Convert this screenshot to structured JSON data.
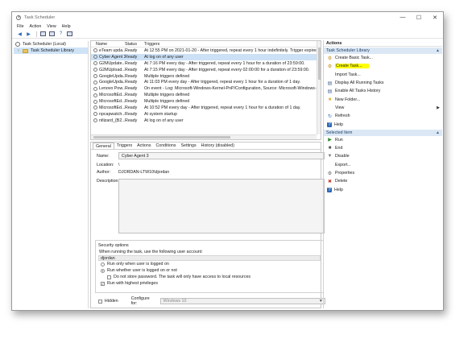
{
  "window": {
    "title": "Task Scheduler",
    "controls": {
      "minimize": "—",
      "maximize": "☐",
      "close": "✕"
    }
  },
  "menubar": [
    "File",
    "Action",
    "View",
    "Help"
  ],
  "tree": {
    "root": "Task Scheduler (Local)",
    "library": "Task Scheduler Library"
  },
  "tasklist": {
    "columns": {
      "name": "Name",
      "status": "Status",
      "triggers": "Triggers"
    },
    "rows": [
      {
        "name": "eTeam upda...",
        "status": "Ready",
        "triggers": "At 12:55 PM on 2021-01-20 - After triggered, repeat every 1 hour indefinitely. Trigger expires at 202"
      },
      {
        "name": "Cyber Agent 3",
        "status": "Ready",
        "triggers": "At log on of any user",
        "selected": true
      },
      {
        "name": "G2MUpdate...",
        "status": "Ready",
        "triggers": "At 7:16 PM every day - After triggered, repeat every 1 hour for a duration of 23:59:00."
      },
      {
        "name": "G2MUpload...",
        "status": "Ready",
        "triggers": "At 7:15 PM every day - After triggered, repeat every 02:00:00 for a duration of 23:59:00."
      },
      {
        "name": "GoogleUpda...",
        "status": "Ready",
        "triggers": "Multiple triggers defined"
      },
      {
        "name": "GoogleUpda...",
        "status": "Ready",
        "triggers": "At 11:03 PM every day - After triggered, repeat every 1 hour for a duration of 1 day."
      },
      {
        "name": "Lenovo Pow...",
        "status": "Ready",
        "triggers": "On event - Log: Microsoft-Windows-Kernel-PnP/Configuration, Source: Microsoft-Windows-Kern"
      },
      {
        "name": "MicrosoftEd...",
        "status": "Ready",
        "triggers": "Multiple triggers defined"
      },
      {
        "name": "MicrosoftEd...",
        "status": "Ready",
        "triggers": "Multiple triggers defined"
      },
      {
        "name": "MicrosoftEd...",
        "status": "Ready",
        "triggers": "At 10:52 PM every day - After triggered, repeat every 1 hour for a duration of 1 day."
      },
      {
        "name": "npcapwatch...",
        "status": "Ready",
        "triggers": "At system startup"
      },
      {
        "name": "ntlizard_{B2...",
        "status": "Ready",
        "triggers": "At log on of any user"
      }
    ]
  },
  "details": {
    "tabs": [
      "General",
      "Triggers",
      "Actions",
      "Conditions",
      "Settings",
      "History (disabled)"
    ],
    "name_label": "Name:",
    "name_value": "Cyber Agent 3",
    "location_label": "Location:",
    "location_value": "\\",
    "author_label": "Author:",
    "author_value": "DJORDAN-LTW10\\djordan",
    "description_label": "Description:",
    "security": {
      "title": "Security options",
      "account_prompt": "When running the task, use the following user account:",
      "account": "djordan",
      "opt_logged_on": "Run only when user is logged on",
      "opt_whether": "Run whether user is logged on or not",
      "opt_no_store": "Do not store password. The task will only have access to local resources",
      "opt_highest": "Run with highest privileges"
    },
    "hidden_label": "Hidden",
    "configure_label": "Configure for:",
    "configure_value": "Windows 10"
  },
  "actions": {
    "header": "Actions",
    "section_library": "Task Scheduler Library",
    "library_items": [
      {
        "icon": "create-basic-task-icon",
        "glyph": "⚙",
        "label": "Create Basic Task..."
      },
      {
        "icon": "create-task-icon",
        "glyph": "⚙",
        "label": "Create Task...",
        "highlight": true
      },
      {
        "icon": "blank-icon",
        "glyph": "",
        "label": "Import Task..."
      },
      {
        "icon": "running-tasks-icon",
        "glyph": "▤",
        "label": "Display All Running Tasks"
      },
      {
        "icon": "history-icon",
        "glyph": "▤",
        "label": "Enable All Tasks History"
      },
      {
        "icon": "new-folder-icon",
        "glyph": "■",
        "label": "New Folder..."
      },
      {
        "icon": "blank-icon",
        "glyph": "",
        "label": "View",
        "submenu": true
      },
      {
        "icon": "refresh-icon",
        "glyph": "↻",
        "label": "Refresh"
      },
      {
        "icon": "help-icon",
        "glyph": "?",
        "label": "Help"
      }
    ],
    "section_selected": "Selected Item",
    "selected_items": [
      {
        "icon": "run-icon",
        "glyph": "▶",
        "label": "Run"
      },
      {
        "icon": "end-icon",
        "glyph": "■",
        "label": "End"
      },
      {
        "icon": "disable-icon",
        "glyph": "▼",
        "label": "Disable"
      },
      {
        "icon": "blank-icon",
        "glyph": "",
        "label": "Export..."
      },
      {
        "icon": "properties-icon",
        "glyph": "⚙",
        "label": "Properties"
      },
      {
        "icon": "delete-icon",
        "glyph": "✖",
        "label": "Delete"
      },
      {
        "icon": "help-icon",
        "glyph": "?",
        "label": "Help"
      }
    ]
  },
  "colors": {
    "highlight": "#ffff00",
    "selection": "#cde1f6",
    "section_bg": "#dbe7f4"
  }
}
